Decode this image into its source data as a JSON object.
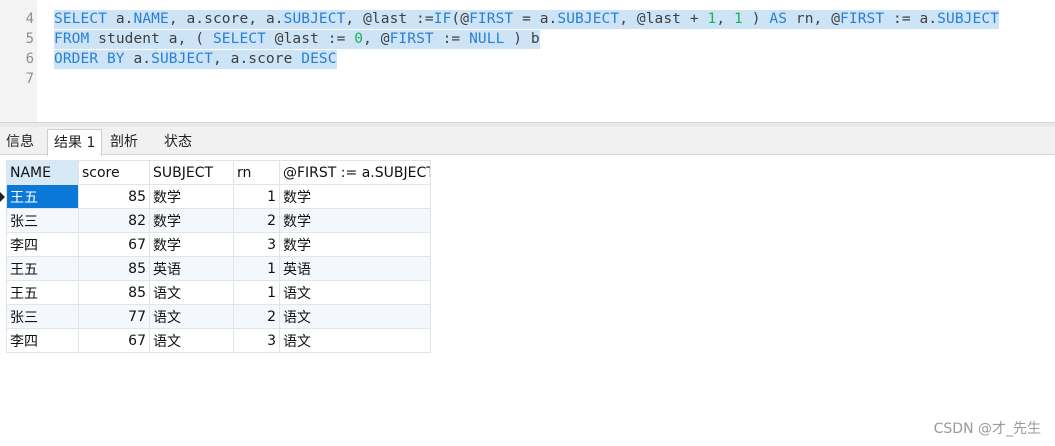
{
  "editor": {
    "line_numbers": [
      "4",
      "5",
      "6",
      "7"
    ],
    "lines": [
      [
        {
          "t": "SELECT",
          "c": "kw"
        },
        {
          "t": " a.",
          "c": "tx"
        },
        {
          "t": "NAME",
          "c": "kw"
        },
        {
          "t": ", a.score, a.",
          "c": "tx"
        },
        {
          "t": "SUBJECT",
          "c": "kw"
        },
        {
          "t": ", @last :=",
          "c": "tx"
        },
        {
          "t": "IF",
          "c": "kw"
        },
        {
          "t": "(@",
          "c": "tx"
        },
        {
          "t": "FIRST",
          "c": "kw"
        },
        {
          "t": " = a.",
          "c": "tx"
        },
        {
          "t": "SUBJECT",
          "c": "kw"
        },
        {
          "t": ", @last + ",
          "c": "tx"
        },
        {
          "t": "1",
          "c": "num"
        },
        {
          "t": ", ",
          "c": "tx"
        },
        {
          "t": "1",
          "c": "num"
        },
        {
          "t": " ) ",
          "c": "tx"
        },
        {
          "t": "AS",
          "c": "kw"
        },
        {
          "t": " rn, @",
          "c": "tx"
        },
        {
          "t": "FIRST",
          "c": "kw"
        },
        {
          "t": " := a.",
          "c": "tx"
        },
        {
          "t": "SUBJECT",
          "c": "kw"
        }
      ],
      [
        {
          "t": "FROM",
          "c": "kw"
        },
        {
          "t": " student a, ( ",
          "c": "tx"
        },
        {
          "t": "SELECT",
          "c": "kw"
        },
        {
          "t": " @last := ",
          "c": "tx"
        },
        {
          "t": "0",
          "c": "num"
        },
        {
          "t": ", @",
          "c": "tx"
        },
        {
          "t": "FIRST",
          "c": "kw"
        },
        {
          "t": " := ",
          "c": "tx"
        },
        {
          "t": "NULL",
          "c": "kw"
        },
        {
          "t": " ) b",
          "c": "tx"
        }
      ],
      [
        {
          "t": "ORDER BY",
          "c": "kw"
        },
        {
          "t": " a.",
          "c": "tx"
        },
        {
          "t": "SUBJECT",
          "c": "kw"
        },
        {
          "t": ", a.score ",
          "c": "tx"
        },
        {
          "t": "DESC",
          "c": "kw"
        }
      ]
    ]
  },
  "tabs": [
    "信息",
    "结果 1",
    "剖析",
    "状态"
  ],
  "active_tab_index": 1,
  "results": {
    "columns": [
      "NAME",
      "score",
      "SUBJECT",
      "rn",
      "@FIRST := a.SUBJECT"
    ],
    "rows": [
      [
        "王五",
        "85",
        "数学",
        "1",
        "数学"
      ],
      [
        "张三",
        "82",
        "数学",
        "2",
        "数学"
      ],
      [
        "李四",
        "67",
        "数学",
        "3",
        "数学"
      ],
      [
        "王五",
        "85",
        "英语",
        "1",
        "英语"
      ],
      [
        "王五",
        "85",
        "语文",
        "1",
        "语文"
      ],
      [
        "张三",
        "77",
        "语文",
        "2",
        "语文"
      ],
      [
        "李四",
        "67",
        "语文",
        "3",
        "语文"
      ]
    ],
    "selected_row": 0
  },
  "watermark": "CSDN @才_先生",
  "colors": {
    "keyword": "#2a7fd4",
    "number": "#19b25b",
    "selection": "#cde4f7",
    "selected_cell": "#0a78d7"
  }
}
